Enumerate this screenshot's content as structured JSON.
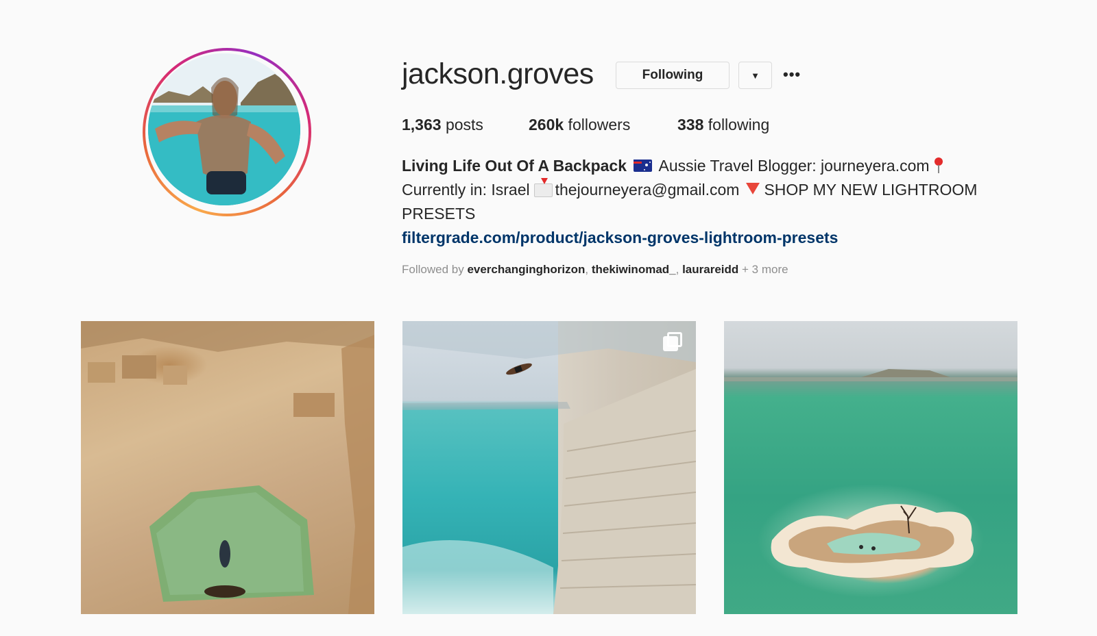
{
  "profile": {
    "username": "jackson.groves",
    "following_button": "Following",
    "dropdown_glyph": "▼",
    "more_glyph": "•••"
  },
  "stats": {
    "posts_count": "1,363",
    "posts_label": " posts",
    "followers_count": "260k",
    "followers_label": " followers",
    "following_count": "338",
    "following_label": " following"
  },
  "bio": {
    "name": "Living Life Out Of A Backpack",
    "line1_rest": "Aussie Travel Blogger: journeyera.com",
    "line2_a": "Currently in: Israel",
    "line2_b": "thejourneyera@gmail.com",
    "line2_c": "SHOP MY NEW LIGHTROOM PRESETS",
    "link": "filtergrade.com/product/jackson-groves-lightroom-presets"
  },
  "followed_by": {
    "prefix": "Followed by ",
    "users": [
      "everchanginghorizon",
      "thekiwinomad_",
      "laurareidd"
    ],
    "more": " + 3 more"
  },
  "posts": [
    {
      "icon": null
    },
    {
      "icon": "multiple-posts-icon"
    },
    {
      "icon": null
    }
  ],
  "colors": {
    "background": "#fafafa",
    "text": "#262626",
    "link": "#003569",
    "muted": "#8e8e8e",
    "ring_start": "#f9a94b",
    "ring_end": "#962fbf"
  }
}
